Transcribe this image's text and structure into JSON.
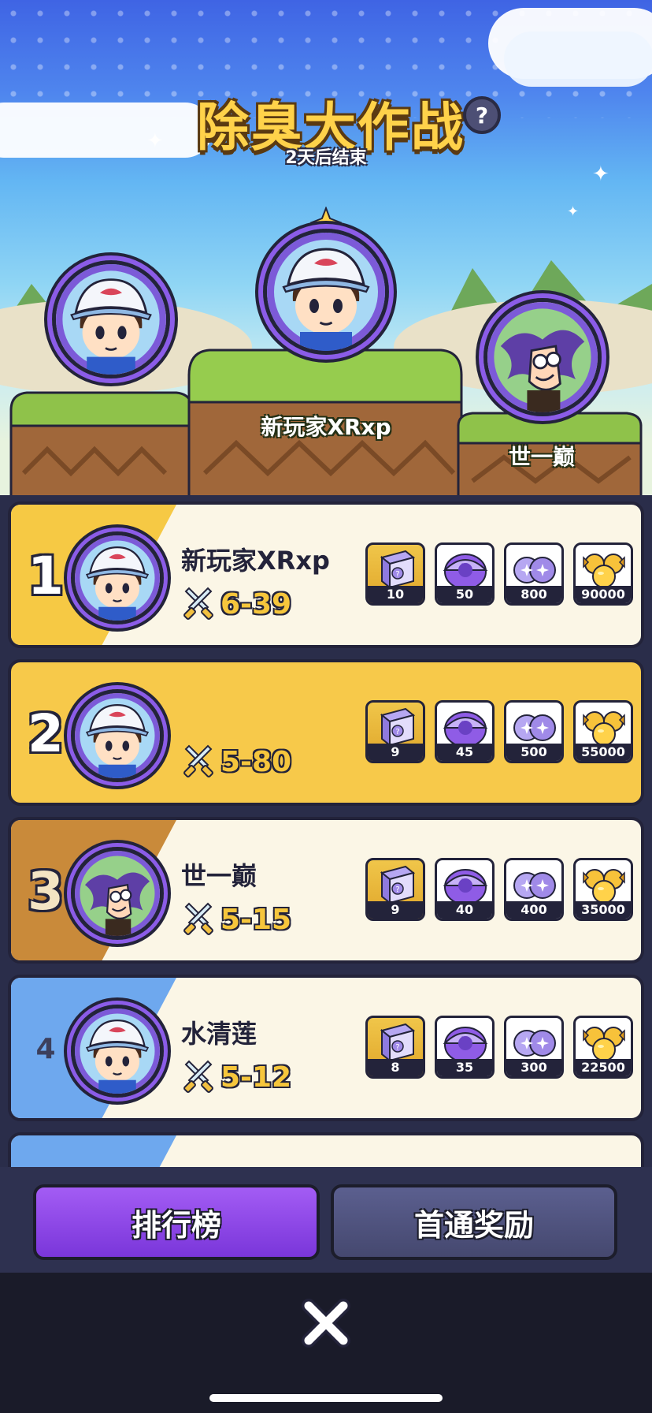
{
  "header": {
    "title": "除臭大作战",
    "help_icon": "?",
    "subtitle": "2天后结束"
  },
  "podium": [
    {
      "position": "first",
      "name": "新玩家XRxp",
      "avatar": "player-boy-cap-icon"
    },
    {
      "position": "second",
      "name": "",
      "avatar": "player-boy-cap-icon"
    },
    {
      "position": "third",
      "name": "世一巅",
      "avatar": "player-green-monster-icon"
    }
  ],
  "rankings": [
    {
      "rank": "1",
      "name": "新玩家XRxp",
      "level": "6-39",
      "rewards": [
        "10",
        "50",
        "800",
        "90000"
      ]
    },
    {
      "rank": "2",
      "name": "",
      "level": "5-80",
      "rewards": [
        "9",
        "45",
        "500",
        "55000"
      ]
    },
    {
      "rank": "3",
      "name": "世一巅",
      "level": "5-15",
      "rewards": [
        "9",
        "40",
        "400",
        "35000"
      ]
    },
    {
      "rank": "4",
      "name": "水清莲",
      "level": "5-12",
      "rewards": [
        "8",
        "35",
        "300",
        "22500"
      ]
    }
  ],
  "reward_icons": [
    "mystery-box-icon",
    "purple-capsule-icon",
    "gem-orbs-icon",
    "gold-candy-icon"
  ],
  "tabs": {
    "leaderboard": "排行榜",
    "first_clear_rewards": "首通奖励"
  },
  "colors": {
    "gold": "#f7c94a",
    "purple": "#8b5ce8",
    "dark": "#23233a",
    "rank1_bg": "#f7c94a",
    "rank3_bg": "#c98a3a",
    "rank4_bg": "#6ea8ee"
  }
}
